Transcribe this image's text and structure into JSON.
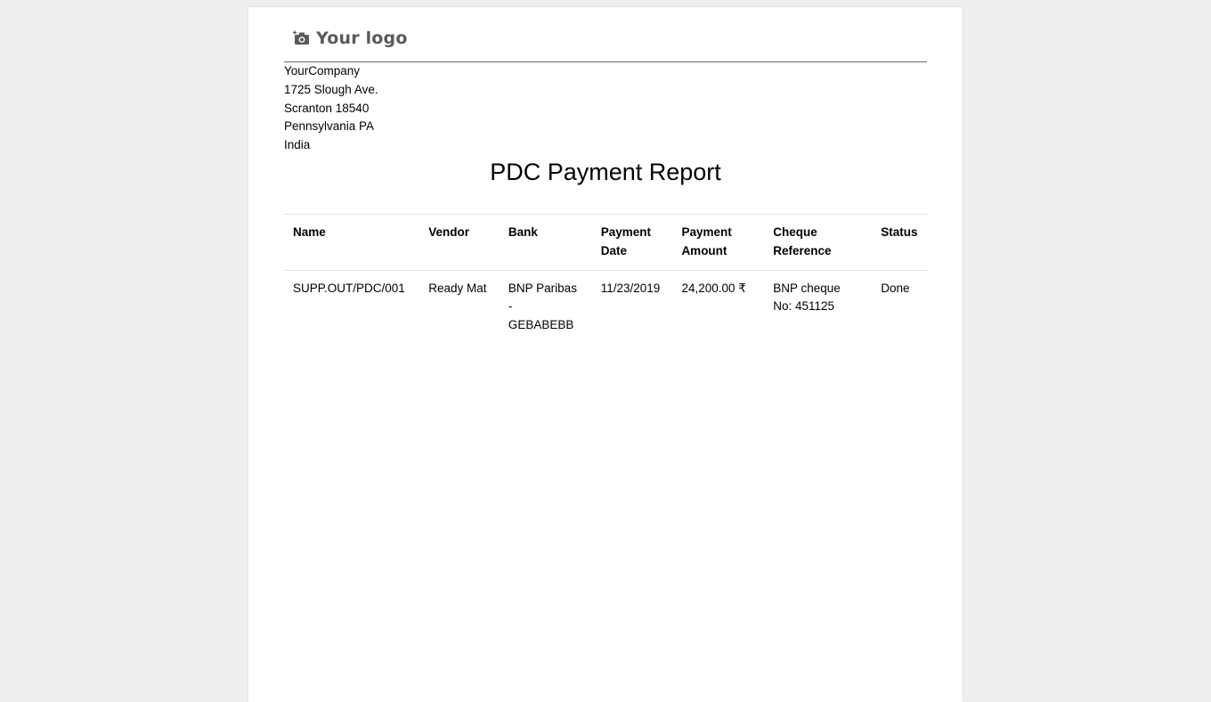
{
  "logo": {
    "text": "Your logo",
    "icon": "camera-icon",
    "color": "#5a5a5a"
  },
  "company": {
    "name": "YourCompany",
    "street": "1725 Slough Ave.",
    "city_zip": "Scranton 18540",
    "state": "Pennsylvania PA",
    "country": "India"
  },
  "report": {
    "title": "PDC Payment Report",
    "columns": {
      "name": "Name",
      "vendor": "Vendor",
      "bank": "Bank",
      "payment_date_1": "Payment",
      "payment_date_2": "Date",
      "payment_amount_1": "Payment",
      "payment_amount_2": "Amount",
      "cheque_ref_1": "Cheque",
      "cheque_ref_2": "Reference",
      "status": "Status"
    },
    "rows": [
      {
        "name": "SUPP.OUT/PDC/001",
        "vendor": "Ready Mat",
        "bank_1": "BNP Paribas",
        "bank_2": "-",
        "bank_3": "GEBABEBB",
        "payment_date": "11/23/2019",
        "payment_amount": "24,200.00 ₹",
        "cheque_ref_1": "BNP cheque",
        "cheque_ref_2": "No: 451125",
        "status": "Done"
      }
    ]
  }
}
